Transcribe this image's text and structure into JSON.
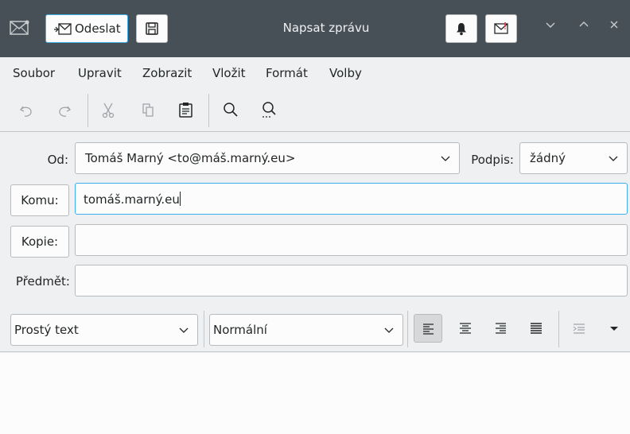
{
  "window": {
    "title": "Napsat zprávu",
    "send_label": "Odeslat",
    "controls": [
      "⌄",
      "⌃",
      "✕"
    ],
    "accent": "#3daee9"
  },
  "menubar": {
    "items": [
      "Soubor",
      "Upravit",
      "Zobrazit",
      "Vložit",
      "Formát",
      "Volby"
    ]
  },
  "toolbar": {
    "icons": [
      "undo-icon",
      "redo-icon",
      "cut-icon",
      "copy-icon",
      "paste-icon",
      "find-icon",
      "find-replace-icon"
    ]
  },
  "form": {
    "from_label": "Od:",
    "from_value": "Tomáš Marný <to@máš.marný.eu>",
    "signature_label": "Podpis:",
    "signature_value": "žádný",
    "to_label": "Komu:",
    "to_value": "tomáš.marný.eu",
    "cc_label": "Kopie:",
    "cc_value": "",
    "subject_label": "Předmět:",
    "subject_value": ""
  },
  "format_bar": {
    "text_mode": "Prostý text",
    "paragraph_style": "Normální",
    "icons": [
      "align-left-icon",
      "align-center-icon",
      "align-right-icon",
      "align-justify-icon",
      "indent-icon",
      "more-dropdown-icon"
    ]
  },
  "editor": {
    "body": ""
  }
}
